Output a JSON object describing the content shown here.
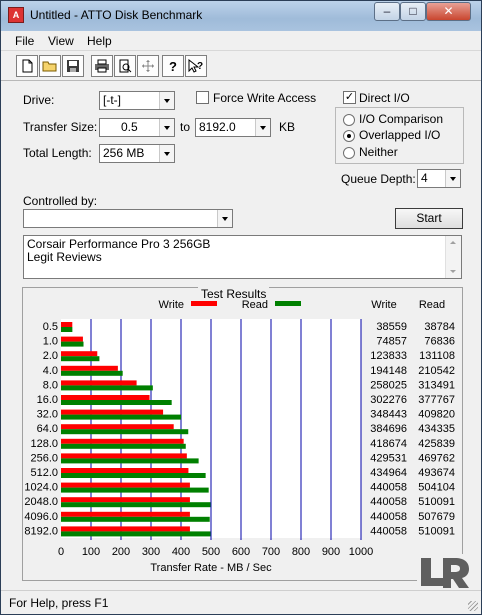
{
  "window": {
    "title": "Untitled - ATTO Disk Benchmark",
    "app_icon_text": "A"
  },
  "menu": [
    "File",
    "View",
    "Help"
  ],
  "toolbar": {
    "buttons": [
      "new-file-icon",
      "open-folder-icon",
      "save-icon",
      "print-icon",
      "print-preview-icon",
      "move-icon",
      "help-icon",
      "context-help-icon"
    ]
  },
  "form": {
    "drive_label": "Drive:",
    "drive_value": "[-t-]",
    "force_write_label": "Force Write Access",
    "force_write_checked": false,
    "direct_io_label": "Direct I/O",
    "direct_io_checked": true,
    "transfer_size_label": "Transfer Size:",
    "transfer_from": "0.5",
    "transfer_to_label": "to",
    "transfer_to": "8192.0",
    "transfer_unit": "KB",
    "total_length_label": "Total Length:",
    "total_length_value": "256 MB",
    "io_options": [
      {
        "label": "I/O Comparison",
        "selected": false
      },
      {
        "label": "Overlapped I/O",
        "selected": true
      },
      {
        "label": "Neither",
        "selected": false
      }
    ],
    "queue_depth_label": "Queue Depth:",
    "queue_depth_value": "4",
    "controlled_by_label": "Controlled by:",
    "controlled_by_value": "",
    "start_label": "Start",
    "description_lines": [
      "Corsair Performance Pro 3 256GB",
      "Legit Reviews"
    ]
  },
  "results": {
    "title": "Test Results",
    "legend_write": "Write",
    "legend_read": "Read",
    "col_write": "Write",
    "col_read": "Read",
    "write_color": "#ff0000",
    "read_color": "#008000"
  },
  "chart_data": {
    "type": "bar",
    "orientation": "horizontal",
    "categories": [
      "0.5",
      "1.0",
      "2.0",
      "4.0",
      "8.0",
      "16.0",
      "32.0",
      "64.0",
      "128.0",
      "256.0",
      "512.0",
      "1024.0",
      "2048.0",
      "4096.0",
      "8192.0"
    ],
    "series": [
      {
        "name": "Write",
        "color": "#ff0000",
        "values": [
          38559,
          74857,
          123833,
          194148,
          258025,
          302276,
          348443,
          384696,
          418674,
          429531,
          434964,
          440058,
          440058,
          440058,
          440058
        ]
      },
      {
        "name": "Read",
        "color": "#008000",
        "values": [
          38784,
          76836,
          131108,
          210542,
          313491,
          377767,
          409820,
          434335,
          425839,
          469762,
          493674,
          504104,
          510091,
          507679,
          510091
        ]
      }
    ],
    "xlabel": "Transfer Rate - MB / Sec",
    "xticks": [
      "0",
      "100",
      "200",
      "300",
      "400",
      "500",
      "600",
      "700",
      "800",
      "900",
      "1000"
    ],
    "xlim": [
      0,
      1000
    ],
    "grid": true
  },
  "statusbar": {
    "text": "For Help, press F1"
  },
  "watermark": {
    "text": "Legit Reviews"
  }
}
